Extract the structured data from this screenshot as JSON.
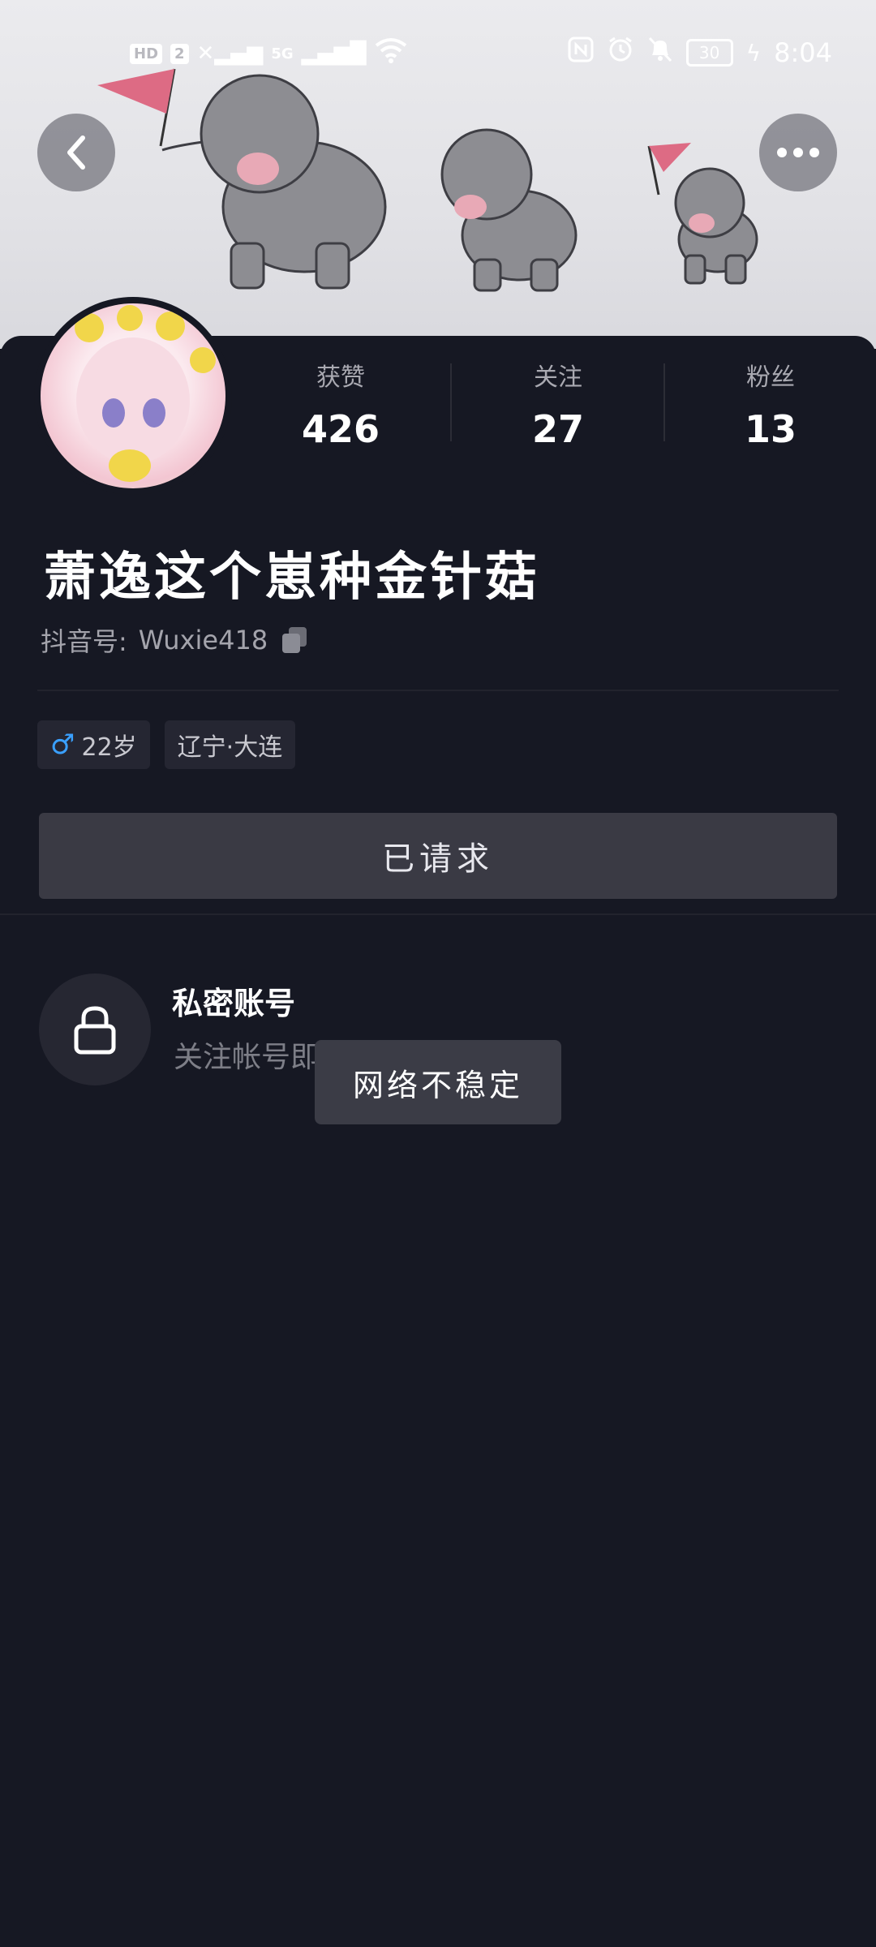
{
  "status_bar": {
    "hd_badge": "HD",
    "sim_badge": "2",
    "network": "5G",
    "battery": "30",
    "time": "8:04"
  },
  "header": {
    "back_icon": "chevron-left-icon",
    "more_icon": "more-dots-icon"
  },
  "profile": {
    "stats": [
      {
        "label": "获赞",
        "value": "426"
      },
      {
        "label": "关注",
        "value": "27"
      },
      {
        "label": "粉丝",
        "value": "13"
      }
    ],
    "nickname": "萧逸这个崽种金针菇",
    "douyin_id_label": "抖音号:",
    "douyin_id": "Wuxie418",
    "tags": {
      "gender_age": "22岁",
      "location": "辽宁·大连"
    },
    "request_button": "已请求"
  },
  "private_account": {
    "title": "私密账号",
    "subtitle": "关注帐号即可查看内容和喜欢"
  },
  "toast": {
    "message": "网络不稳定"
  },
  "colors": {
    "background": "#161823",
    "male_icon": "#3aa0ff",
    "button": "#3a3a44"
  }
}
